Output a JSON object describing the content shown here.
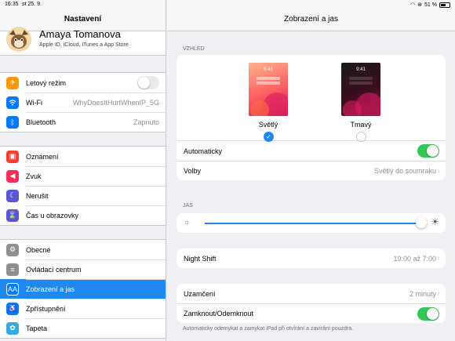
{
  "status": {
    "time": "16:35",
    "date": "st 25. 9.",
    "battery": "51 %"
  },
  "sidebar": {
    "title": "Nastavení",
    "profile": {
      "name": "Amaya Tomanova",
      "subtitle": "Apple ID, iCloud, iTunes a App Store"
    },
    "groups": [
      [
        {
          "label": "Letový režim",
          "icon": "airplane-icon",
          "color": "#ff9500"
        },
        {
          "label": "Wi-Fi",
          "value": "WhyDoesItHurtWhenIP_5G",
          "icon": "wifi-icon",
          "color": "#007aff"
        },
        {
          "label": "Bluetooth",
          "value": "Zapnuto",
          "icon": "bluetooth-icon",
          "color": "#007aff"
        }
      ],
      [
        {
          "label": "Oznámení",
          "icon": "notifications-icon",
          "color": "#ff3b30"
        },
        {
          "label": "Zvuk",
          "icon": "sound-icon",
          "color": "#ff2d55"
        },
        {
          "label": "Nerušit",
          "icon": "moon-icon",
          "color": "#5856d6"
        },
        {
          "label": "Čas u obrazovky",
          "icon": "hourglass-icon",
          "color": "#5856d6"
        }
      ],
      [
        {
          "label": "Obecné",
          "icon": "gear-icon",
          "color": "#8e8e93"
        },
        {
          "label": "Ovládací centrum",
          "icon": "switches-icon",
          "color": "#8e8e93"
        },
        {
          "label": "Zobrazení a jas",
          "icon": "display-icon",
          "color": "#007aff"
        },
        {
          "label": "Zpřístupnění",
          "icon": "accessibility-icon",
          "color": "#007aff"
        },
        {
          "label": "Tapeta",
          "icon": "wallpaper-icon",
          "color": "#34aadc"
        }
      ]
    ]
  },
  "main": {
    "title": "Zobrazení a jas",
    "appearance_label": "VZHLED",
    "light": {
      "label": "Světlý",
      "clock": "9:41"
    },
    "dark": {
      "label": "Tmavý",
      "clock": "9:41"
    },
    "automatic": "Automaticky",
    "options": {
      "label": "Volby",
      "value": "Světlý do soumraku"
    },
    "brightness_label": "JAS",
    "brightness_level": 0.95,
    "night_shift": {
      "label": "Night Shift",
      "value": "19:00 až 7:00"
    },
    "auto_lock": {
      "label": "Uzamčení",
      "value": "2 minuty"
    },
    "lock_unlock": "Zamknout/Odemknout",
    "footnote": "Automaticky odemykat a zamykat iPad při otvírání a zavírání pouzdra."
  }
}
